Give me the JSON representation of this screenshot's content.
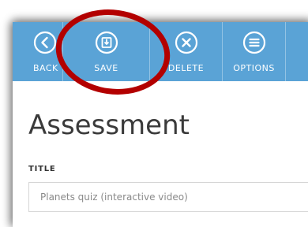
{
  "toolbar": {
    "background": "#5aa3d6",
    "items": [
      {
        "label": "BACK",
        "icon": "chevron-left-circle-icon"
      },
      {
        "label": "SAVE",
        "icon": "save-icon"
      },
      {
        "label": "DELETE",
        "icon": "close-circle-icon"
      },
      {
        "label": "OPTIONS",
        "icon": "menu-circle-icon"
      }
    ]
  },
  "page": {
    "title": "Assessment"
  },
  "form": {
    "title_label": "TITLE",
    "title_value": "Planets quiz (interactive video)"
  },
  "annotation": {
    "color": "#b30000",
    "shape": "ellipse",
    "target": "SAVE"
  }
}
